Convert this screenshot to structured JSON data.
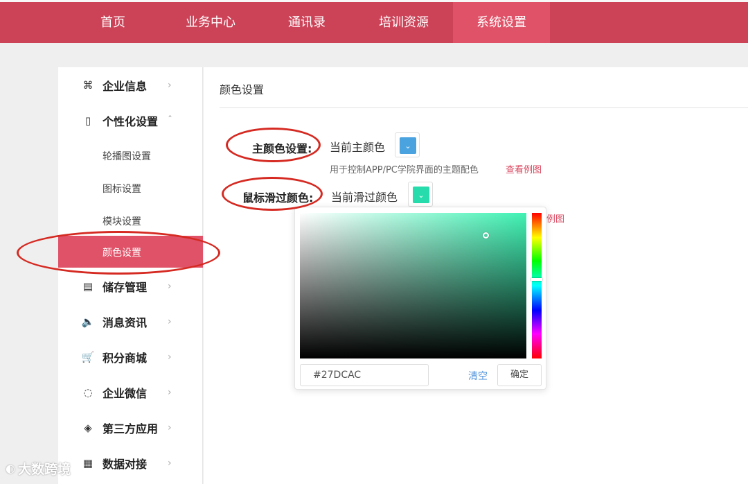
{
  "topnav": {
    "items": [
      {
        "label": "首页"
      },
      {
        "label": "业务中心"
      },
      {
        "label": "通讯录"
      },
      {
        "label": "培训资源"
      },
      {
        "label": "系统设置"
      }
    ],
    "active": "系统设置"
  },
  "sidebar": {
    "items": [
      {
        "label": "企业信息",
        "icon": "command-icon",
        "glyph": "⌘",
        "chevron": "›"
      },
      {
        "label": "个性化设置",
        "icon": "phone-icon",
        "glyph": "▯",
        "chevron": "ˆ"
      },
      {
        "label": "储存管理",
        "icon": "storage-icon",
        "glyph": "▤",
        "chevron": "›"
      },
      {
        "label": "消息资讯",
        "icon": "speaker-icon",
        "glyph": "🔈",
        "chevron": "›"
      },
      {
        "label": "积分商城",
        "icon": "cart-icon",
        "glyph": "🛒",
        "chevron": "›"
      },
      {
        "label": "企业微信",
        "icon": "chat-icon",
        "glyph": "◌",
        "chevron": "›"
      },
      {
        "label": "第三方应用",
        "icon": "cube-icon",
        "glyph": "◈",
        "chevron": "›"
      },
      {
        "label": "数据对接",
        "icon": "data-icon",
        "glyph": "▦",
        "chevron": "›"
      }
    ],
    "subitems": [
      {
        "label": "轮播图设置"
      },
      {
        "label": "图标设置"
      },
      {
        "label": "模块设置"
      },
      {
        "label": "颜色设置"
      }
    ],
    "active_sub": "颜色设置"
  },
  "content": {
    "title": "颜色设置",
    "primary": {
      "label": "主颜色设置:",
      "current_text": "当前主颜色",
      "color": "#4aa3df",
      "hint": "用于控制APP/PC学院界面的主题配色",
      "link": "查看例图"
    },
    "hover": {
      "label": "鼠标滑过颜色:",
      "current_text": "当前滑过颜色",
      "color": "#27dcac",
      "link_partial": "例图"
    }
  },
  "picker": {
    "hex_value": "#27DCAC",
    "clear_label": "清空",
    "ok_label": "确定"
  },
  "watermark": {
    "text": "大数跨境"
  },
  "colors": {
    "brand": "#cc4358",
    "active": "#e05268",
    "annotation": "#d52a22",
    "link": "#d94a61"
  }
}
